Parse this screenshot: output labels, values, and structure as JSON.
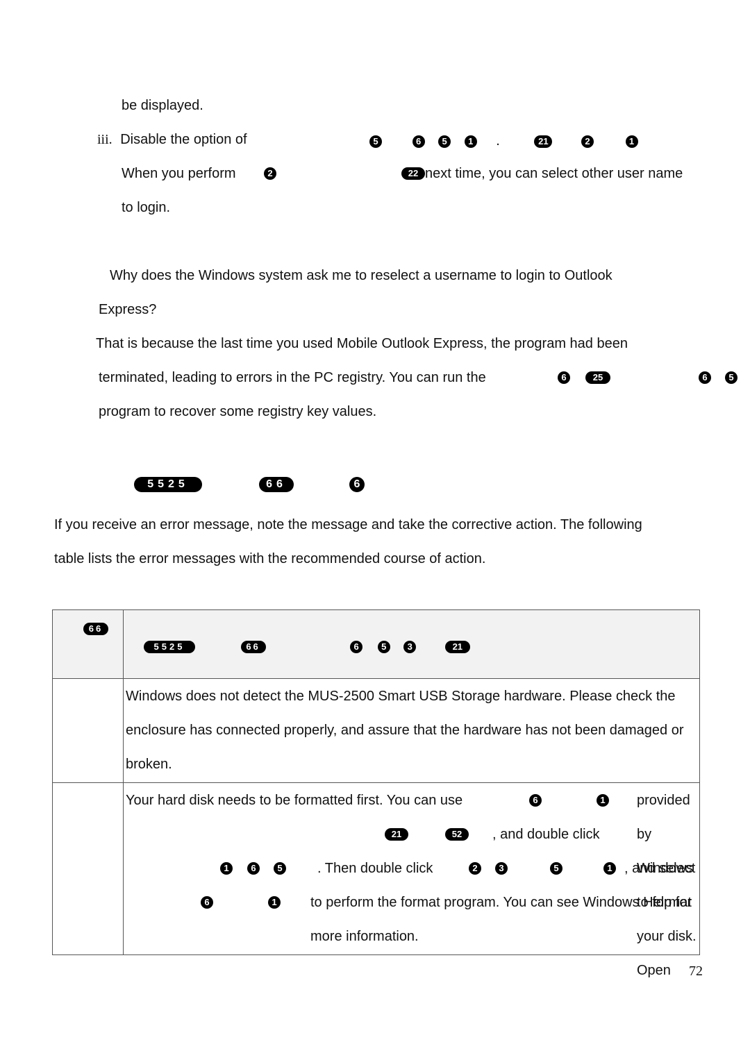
{
  "top_section": {
    "line1": "be displayed.",
    "item_marker": "iii.",
    "item_text": "Disable the option of",
    "item_glyphs": [
      "5",
      "6",
      "5",
      "1",
      ".",
      "21",
      "2",
      "1"
    ],
    "line3_start": "When you perform",
    "line3_glyph1": "2",
    "line3_glyph2": "22",
    "line3_rest": "next time, you can select other user name",
    "line4": "to login."
  },
  "faq": {
    "question_line1": "Why does the Windows system ask me to reselect a username to login to Outlook",
    "question_line2": "Express?",
    "answer_line1": "That is because the last time you used Mobile Outlook Express, the program had been",
    "answer_line2": "terminated, leading to errors in the PC registry. You can run the",
    "answer_glyphs": [
      "6",
      "25",
      "6",
      "5"
    ],
    "answer_line3": "program to recover some registry key values."
  },
  "section_heading": {
    "glyphs": [
      "5525",
      "66",
      "6"
    ]
  },
  "intro": {
    "line1": "If you receive an error message, note the message and take the corrective action. The following",
    "line2": "table lists the error messages with the recommended course of action."
  },
  "table": {
    "header_col1_glyphs": "66",
    "header_col2_glyphs": [
      "5525",
      "66",
      "6",
      "5",
      "3",
      "21"
    ],
    "rows": [
      {
        "code": "",
        "text": "Windows does not detect the MUS-2500 Smart USB Storage hardware. Please check the enclosure has connected properly, and assure that the hardware has not been damaged or broken."
      },
      {
        "code": "",
        "text_parts": {
          "p1": "Your hard disk needs to be formatted first. You can use",
          "p2": "provided by Windows to format your disk. Open",
          "p3": ", and double click",
          "p4": ". Then double click",
          "p5": ", and select",
          "p6": "to perform the format program. You can see Windows Help for more information."
        }
      }
    ]
  },
  "footer": {
    "page_number": "72"
  }
}
